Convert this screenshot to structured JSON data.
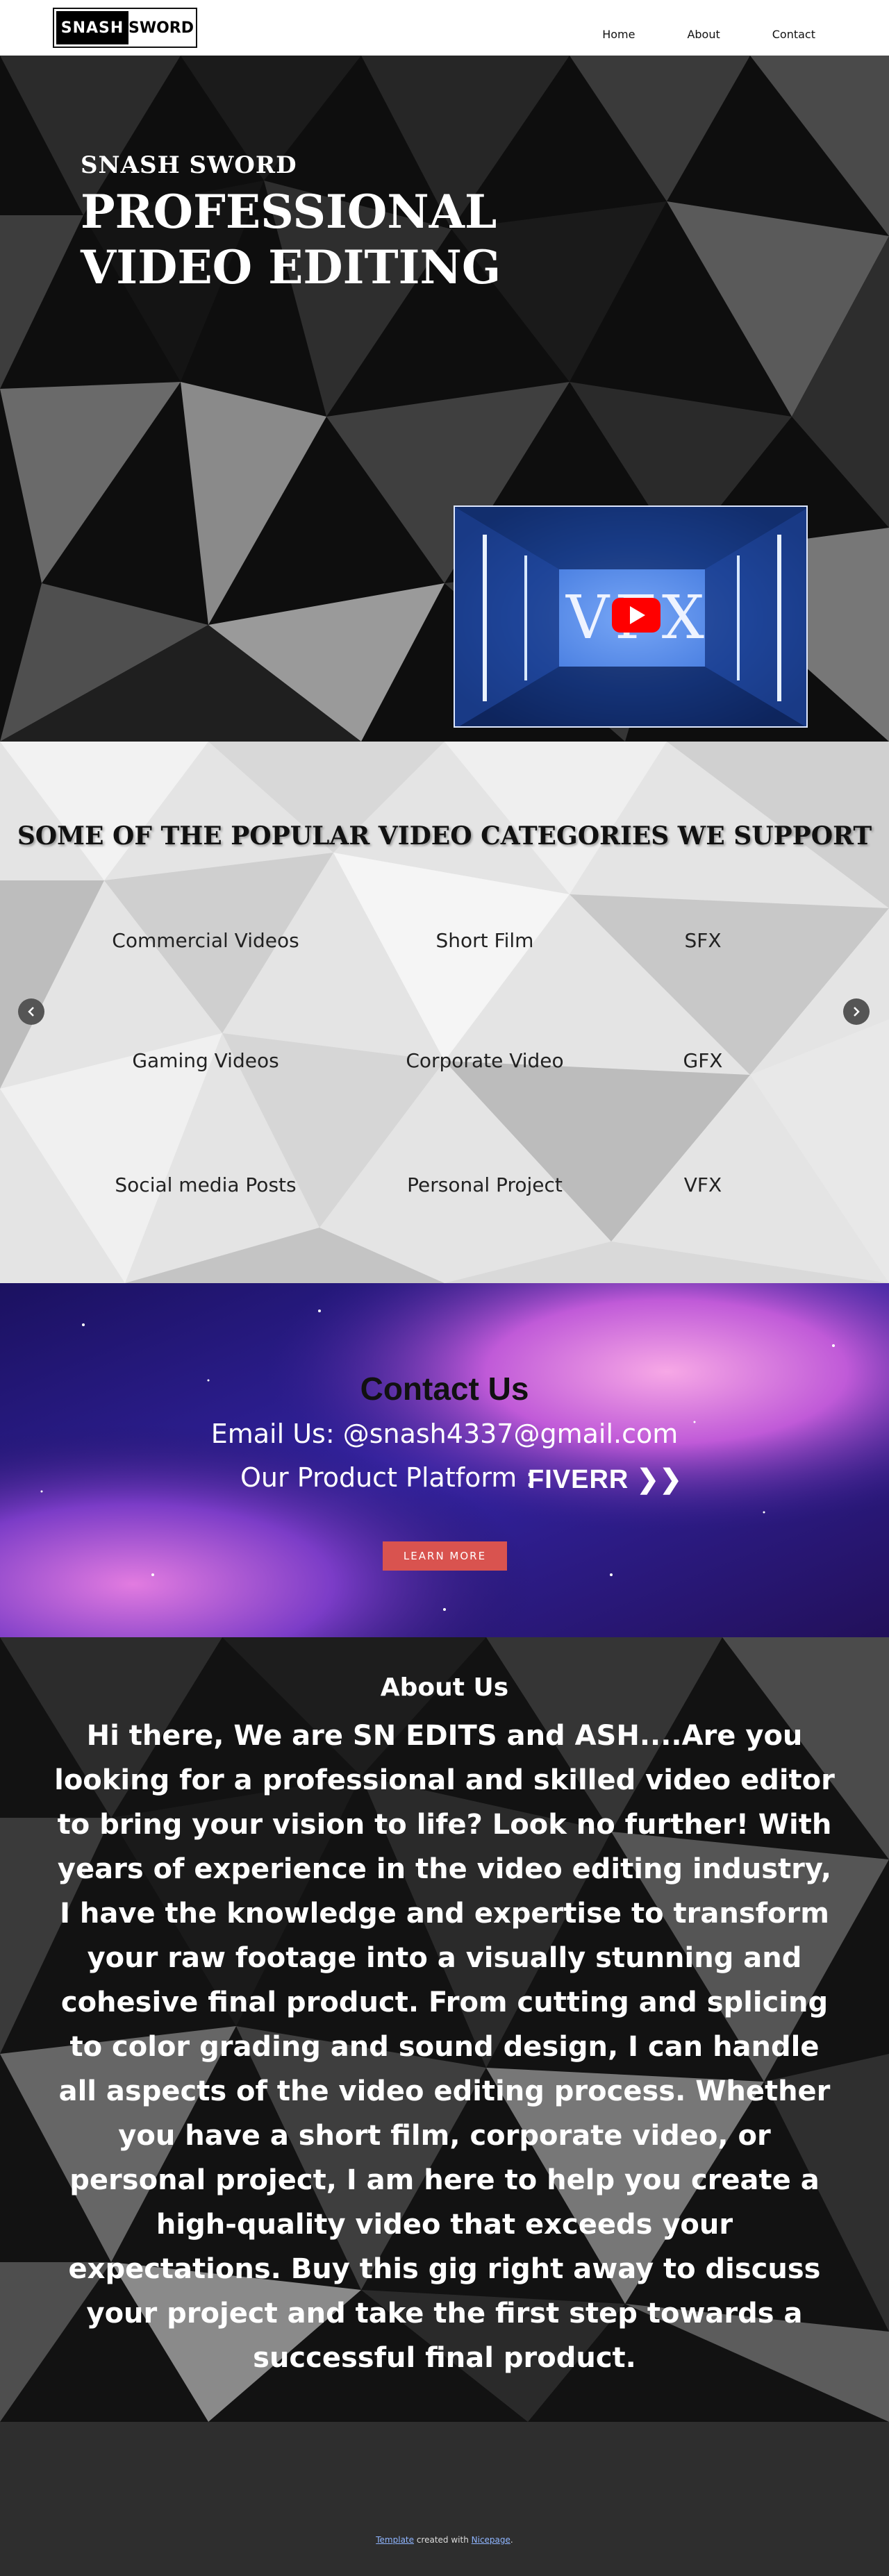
{
  "header": {
    "logo_left": "SNASH",
    "logo_right": "SWORD",
    "nav": [
      {
        "label": "Home"
      },
      {
        "label": "About"
      },
      {
        "label": "Contact"
      }
    ]
  },
  "hero": {
    "subtitle": "SNASH SWORD",
    "title": "PROFESSIONAL VIDEO EDITING",
    "video_text": "VFX",
    "video_play_icon": "youtube-play-icon"
  },
  "categories": {
    "heading": "SOME OF THE POPULAR VIDEO CATEGORIES WE SUPPORT",
    "items": [
      "Commercial Videos",
      "Short Film",
      "SFX",
      "Gaming Videos",
      "Corporate Video",
      "GFX",
      "Social media Posts",
      "Personal Project",
      "VFX"
    ]
  },
  "contact": {
    "title": "Contact Us",
    "email": "Email Us: @snash4337@gmail.com",
    "platform_label": "Our Product Platform :",
    "platform_name": "FIVERR",
    "button": "LEARN MORE"
  },
  "about": {
    "title": "About Us",
    "body": "Hi there, We are SN EDITS and ASH....Are you looking for a professional and skilled video editor to bring your vision to life? Look no further! With years of experience in the video editing industry, I have the knowledge and expertise to transform your raw footage into a visually stunning and cohesive final product. From cutting and splicing to color grading and sound design, I can handle all aspects of the video editing process. Whether you have a short film, corporate video, or personal project, I am here to help you create a high-quality video that exceeds your expectations. Buy this gig right away to discuss your project and take the first step towards a successful final product."
  },
  "footer": {
    "link1": "Template",
    "middle": " created with ",
    "link2": "Nicepage",
    "end": "."
  },
  "colors": {
    "accent_button": "#d9534f",
    "dark_section": "#111111",
    "footer_bg": "#2e2e2e"
  }
}
